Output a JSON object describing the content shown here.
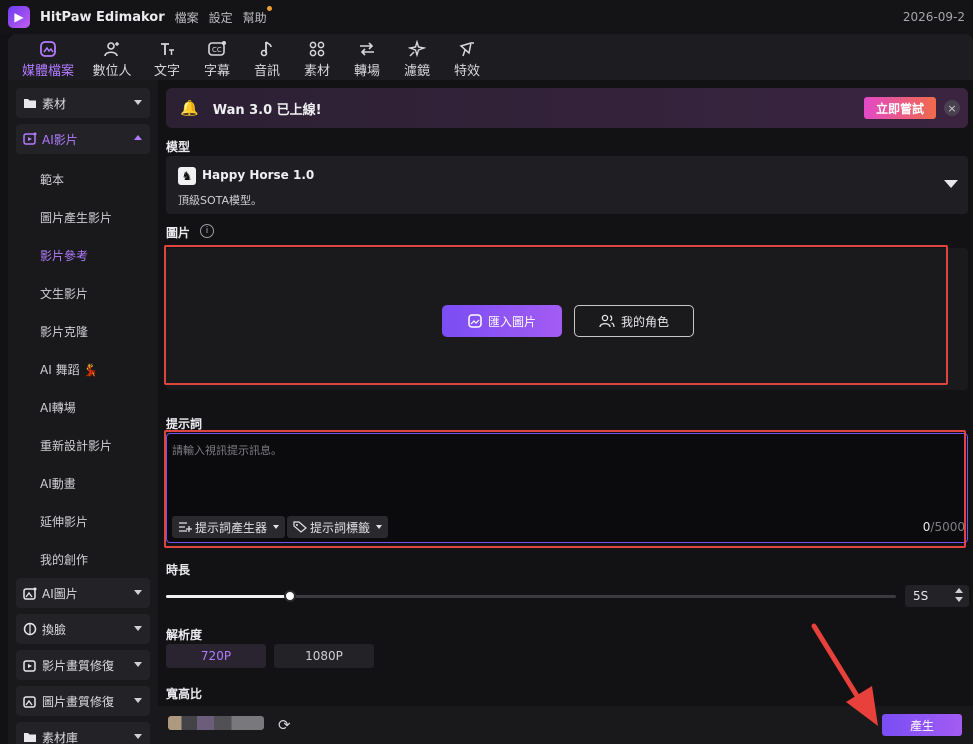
{
  "titlebar": {
    "app_name": "HitPaw Edimakor",
    "menu": [
      "檔案",
      "設定",
      "幫助"
    ],
    "date": "2026-09-2"
  },
  "toolbar": {
    "tabs": [
      {
        "label": "媒體檔案",
        "icon": "media-icon"
      },
      {
        "label": "數位人",
        "icon": "avatar-add-icon"
      },
      {
        "label": "文字",
        "icon": "text-icon"
      },
      {
        "label": "字幕",
        "icon": "subtitle-icon"
      },
      {
        "label": "音訊",
        "icon": "music-note-icon"
      },
      {
        "label": "素材",
        "icon": "elements-icon"
      },
      {
        "label": "轉場",
        "icon": "transition-icon"
      },
      {
        "label": "濾鏡",
        "icon": "filter-icon"
      },
      {
        "label": "特效",
        "icon": "effects-icon"
      }
    ]
  },
  "sidebar": {
    "cat_assets": "素材",
    "cat_ai_video": "AI影片",
    "sub_items": [
      "範本",
      "圖片產生影片",
      "影片參考",
      "文生影片",
      "影片克隆",
      "AI 舞蹈 💃",
      "AI轉場",
      "重新設計影片",
      "AI動畫",
      "延伸影片",
      "我的創作"
    ],
    "cat_ai_image": "AI圖片",
    "cat_face_swap": "換臉",
    "cat_video_enhance": "影片畫質修復",
    "cat_image_enhance": "圖片畫質修復",
    "cat_library": "素材庫"
  },
  "banner": {
    "text": "Wan 3.0 已上線!",
    "try_label": "立即嘗試",
    "close_label": "×"
  },
  "model": {
    "section": "模型",
    "name": "Happy Horse 1.0",
    "desc": "頂級SOTA模型。"
  },
  "image": {
    "section": "圖片",
    "import_label": "匯入圖片",
    "role_label": "我的角色"
  },
  "prompt": {
    "section": "提示詞",
    "placeholder": "請輸入視訊提示訊息。",
    "generator_label": "提示詞產生器",
    "tags_label": "提示詞標籤",
    "count": "0",
    "max": "/5000"
  },
  "duration": {
    "section": "時長",
    "value": "5S",
    "slider_fraction": 0.17
  },
  "resolution": {
    "section": "解析度",
    "options": [
      "720P",
      "1080P"
    ],
    "selected": "720P"
  },
  "aspect": {
    "section": "寬高比"
  },
  "generate_label": "產生",
  "colors": {
    "accent": "#b27bff",
    "highlight": "#e0443e",
    "bg": "#121214"
  }
}
